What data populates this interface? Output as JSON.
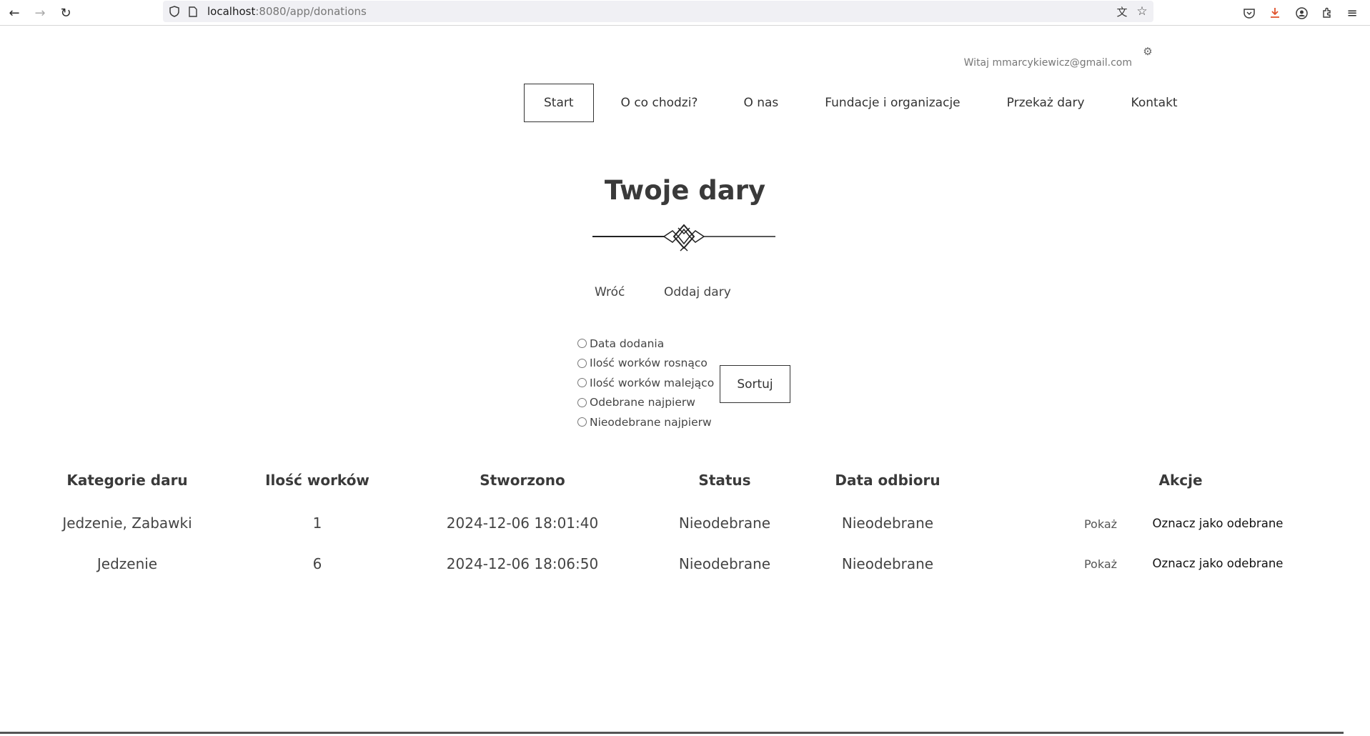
{
  "browser": {
    "url_host": "localhost",
    "url_path": ":8080/app/donations"
  },
  "header": {
    "greeting": "Witaj mmarcykiewicz@gmail.com",
    "nav": [
      {
        "label": "Start"
      },
      {
        "label": "O co chodzi?"
      },
      {
        "label": "O nas"
      },
      {
        "label": "Fundacje i organizacje"
      },
      {
        "label": "Przekaż dary"
      },
      {
        "label": "Kontakt"
      }
    ]
  },
  "main": {
    "title": "Twoje dary",
    "back_link": "Wróć",
    "donate_link": "Oddaj dary",
    "sort_options": [
      "Data dodania",
      "Ilość worków rosnąco",
      "Ilość worków malejąco",
      "Odebrane najpierw",
      "Nieodebrane najpierw"
    ],
    "sort_button": "Sortuj"
  },
  "table": {
    "headers": {
      "category": "Kategorie daru",
      "bags": "Ilość worków",
      "created": "Stworzono",
      "status": "Status",
      "pickup": "Data odbioru",
      "actions": "Akcje"
    },
    "rows": [
      {
        "category": "Jedzenie, Zabawki",
        "bags": "1",
        "created": "2024-12-06 18:01:40",
        "status": "Nieodebrane",
        "pickup": "Nieodebrane",
        "show": "Pokaż",
        "mark": "Oznacz jako odebrane"
      },
      {
        "category": "Jedzenie",
        "bags": "6",
        "created": "2024-12-06 18:06:50",
        "status": "Nieodebrane",
        "pickup": "Nieodebrane",
        "show": "Pokaż",
        "mark": "Oznacz jako odebrane"
      }
    ]
  }
}
